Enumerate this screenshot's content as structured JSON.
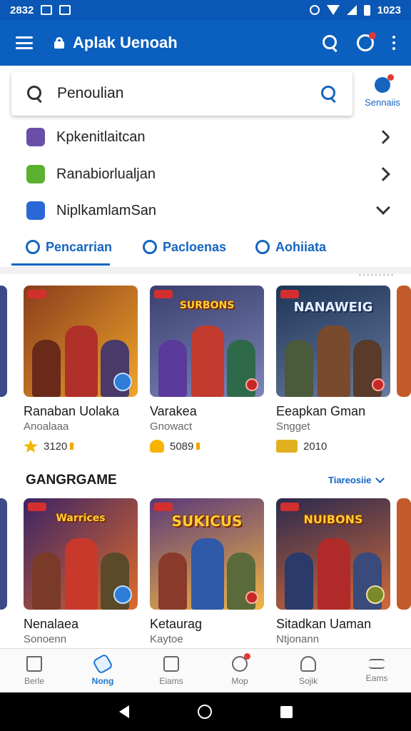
{
  "status_bar": {
    "time_left": "2832",
    "time_right": "1023"
  },
  "app_bar": {
    "title": "Aplak Uenoah"
  },
  "search": {
    "value": "Penoulian",
    "side_label": "Sennaiis"
  },
  "suggestions": [
    {
      "label": "Kpkenitlaitcan",
      "icon": "game-app-icon",
      "color": "#6b4ea8"
    },
    {
      "label": "Ranabiorlualjan",
      "icon": "green-app-icon",
      "color": "#5cb030"
    },
    {
      "label": "NiplkamlamSan",
      "icon": "blue-app-icon",
      "color": "#2a68d8"
    }
  ],
  "tabs": [
    {
      "label": "Pencarrian",
      "icon": "search-icon"
    },
    {
      "label": "Pacloenas",
      "icon": "edit-icon"
    },
    {
      "label": "Aohiiata",
      "icon": "compass-icon"
    }
  ],
  "row1": [
    {
      "name": "Ranaban Uolaka",
      "sub": "Anoalaaa",
      "meta": "3120",
      "banner": "",
      "bg": "#8a3c1c",
      "bg2": "#f0a52a",
      "fig": "#b2302a",
      "meta_color": "#f4b400"
    },
    {
      "name": "Varakea",
      "sub": "Gnowact",
      "meta": "5089",
      "banner": "SURBONS",
      "bg": "#3a3f6e",
      "bg2": "#7c86b8",
      "fig": "#c23b2e",
      "meta_color": "#f4b400"
    },
    {
      "name": "Eeapkan Gman",
      "sub": "Sngget",
      "meta": "2010",
      "banner": "NANAWEIG",
      "bg": "#1d3556",
      "bg2": "#6a7aa0",
      "fig": "#7a4a2c",
      "meta_color": "#e0b020"
    }
  ],
  "section": {
    "title": "GANGRGAME",
    "more_label": "Tiareosiie"
  },
  "row2": [
    {
      "name": "Nenalaea",
      "sub": "Sonoenn",
      "banner": "Warrices",
      "bg": "#3a2466",
      "bg2": "#e06a2a",
      "fig": "#c8392c"
    },
    {
      "name": "Ketaurag",
      "sub": "Kaytoe",
      "banner": "SUKICUS",
      "bg": "#5a3a7a",
      "bg2": "#f2b544",
      "fig": "#2f5aa8"
    },
    {
      "name": "Sitadkan Uaman",
      "sub": "Ntjonann",
      "banner": "NUIBONS",
      "bg": "#2b2a4e",
      "bg2": "#d26a3a",
      "fig": "#b12a2a"
    }
  ],
  "bottom_nav": [
    {
      "label": "Berle",
      "icon": "home-icon"
    },
    {
      "label": "Nong",
      "icon": "tag-icon",
      "active": true
    },
    {
      "label": "Eiams",
      "icon": "list-icon"
    },
    {
      "label": "Mop",
      "icon": "clock-icon",
      "badge": true
    },
    {
      "label": "Sojik",
      "icon": "person-icon"
    },
    {
      "label": "Eams",
      "icon": "menu-icon"
    }
  ]
}
